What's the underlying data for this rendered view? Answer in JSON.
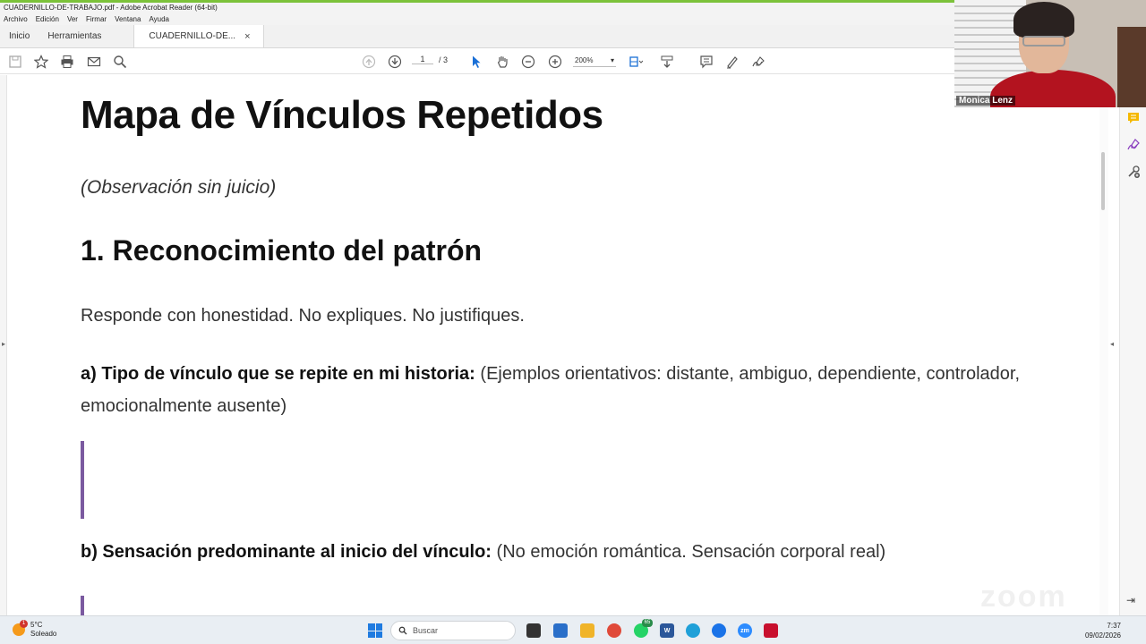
{
  "window": {
    "title": "CUADERNILLO-DE-TRABAJO.pdf - Adobe Acrobat Reader (64-bit)"
  },
  "menu": [
    "Archivo",
    "Edición",
    "Ver",
    "Firmar",
    "Ventana",
    "Ayuda"
  ],
  "tabs": {
    "home": "Inicio",
    "tools": "Herramientas",
    "document": "CUADERNILLO-DE...",
    "close": "×"
  },
  "toolbar": {
    "page_current": "1",
    "page_total": "/ 3",
    "zoom": "200%",
    "icons": [
      "save-icon",
      "star-icon",
      "print-icon",
      "email-icon",
      "search-icon",
      "page-up-icon",
      "page-down-icon",
      "select-cursor-icon",
      "hand-icon",
      "zoom-out-icon",
      "zoom-in-icon",
      "fit-page-icon",
      "scroll-icon",
      "comment-icon",
      "highlight-icon",
      "sign-icon"
    ]
  },
  "document": {
    "title": "Mapa de Vínculos Repetidos",
    "subtitle": "(Observación sin juicio)",
    "section_heading": "1. Reconocimiento del patrón",
    "intro": "Responde con honestidad. No expliques. No justifiques.",
    "question_a": {
      "label": "a) Tipo de vínculo que se repite en mi historia:",
      "text": "(Ejemplos orientativos: distante, ambiguo, dependiente, controlador, emocionalmente ausente)"
    },
    "question_b": {
      "label": "b) Sensación predominante al inicio del vínculo:",
      "text": "(No emoción romántica. Sensación corporal real)"
    }
  },
  "video": {
    "participant": "Monica Lenz"
  },
  "watermark": "zoom",
  "taskbar": {
    "weather_temp": "5°C",
    "weather_desc": "Soleado",
    "weather_badge": "1",
    "search_placeholder": "Buscar",
    "whatsapp_badge": "65",
    "time": "7:37",
    "date": "09/02/2026"
  },
  "colors": {
    "zoom_border": "#7cc23a",
    "answer_bar": "#7b5aa0",
    "acrobat_red": "#c8102e"
  }
}
